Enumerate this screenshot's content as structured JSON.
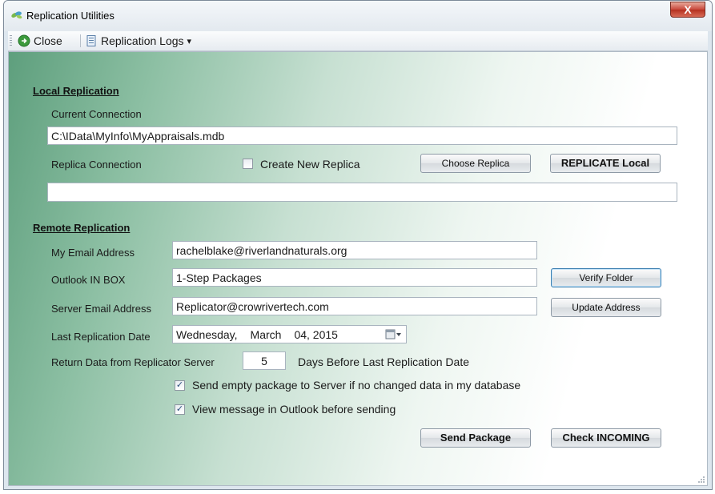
{
  "window": {
    "title": "Replication Utilities",
    "close_glyph": "X"
  },
  "toolbar": {
    "close_label": "Close",
    "logs_label": "Replication Logs",
    "logs_arrow": "▾"
  },
  "local": {
    "section_title": "Local Replication",
    "current_connection_label": "Current Connection",
    "current_connection_value": "C:\\IData\\MyInfo\\MyAppraisals.mdb",
    "replica_connection_label": "Replica Connection",
    "create_new_replica_label": "Create New Replica",
    "create_new_replica_checked": false,
    "choose_replica_label": "Choose Replica",
    "replicate_local_label": "REPLICATE Local",
    "replica_connection_value": ""
  },
  "remote": {
    "section_title": "Remote Replication",
    "email_label": "My Email Address",
    "email_value": "rachelblake@riverlandnaturals.org",
    "inbox_label": "Outlook IN BOX",
    "inbox_value": "1-Step Packages",
    "verify_folder_label": "Verify Folder",
    "server_email_label": "Server Email Address",
    "server_email_value": "Replicator@crowrivertech.com",
    "update_address_label": "Update Address",
    "last_date_label": "Last Replication Date",
    "last_date_weekday": "Wednesday,",
    "last_date_month": "March",
    "last_date_day_year": "04, 2015",
    "return_data_label": "Return Data from Replicator Server",
    "return_days_value": "5",
    "return_days_suffix": "Days Before Last Replication Date",
    "send_empty_label": "Send empty package to Server if no changed data in my database",
    "send_empty_checked": true,
    "view_message_label": "View message in Outlook before sending",
    "view_message_checked": true,
    "send_package_label": "Send Package",
    "check_incoming_label": "Check INCOMING"
  },
  "colors": {
    "accent_green": "#5e9f7d",
    "close_red": "#c8473a"
  }
}
